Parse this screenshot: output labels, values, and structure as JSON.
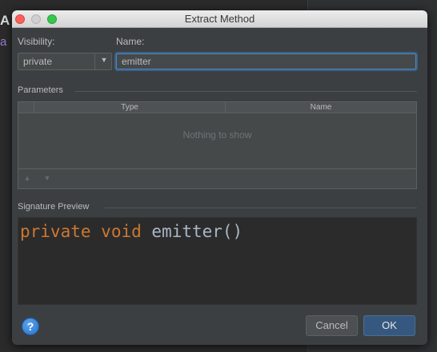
{
  "background": {
    "fragment_a": "A",
    "fragment_b": "a"
  },
  "window": {
    "title": "Extract Method"
  },
  "form": {
    "visibility_label": "Visibility:",
    "visibility_value": "private",
    "name_label": "Name:",
    "name_value": "emitter"
  },
  "parameters": {
    "section_label": "Parameters",
    "columns": [
      "Type",
      "Name"
    ],
    "empty_text": "Nothing to show",
    "move_up_icon": "triangle-up",
    "move_down_icon": "triangle-down"
  },
  "signature": {
    "section_label": "Signature Preview",
    "keyword_1": "private",
    "keyword_2": "void",
    "method": "emitter()"
  },
  "buttons": {
    "help": "?",
    "cancel": "Cancel",
    "ok": "OK"
  },
  "colors": {
    "dialog_bg": "#3c3f41",
    "editor_bg": "#2b2b2b",
    "keyword": "#cc7832",
    "identifier": "#a9b7c6",
    "focus_ring": "#4b87c5",
    "ok_button": "#365880"
  }
}
